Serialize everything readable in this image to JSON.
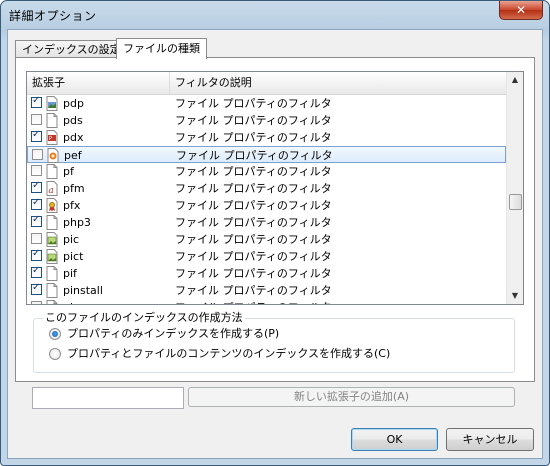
{
  "window": {
    "title": "詳細オプション",
    "close_glyph": "✕"
  },
  "tabs": [
    {
      "label": "インデックスの設定",
      "active": false
    },
    {
      "label": "ファイルの種類",
      "active": true
    }
  ],
  "list": {
    "columns": [
      "拡張子",
      "フィルタの説明"
    ],
    "rows": [
      {
        "ext": "pdp",
        "desc": "ファイル プロパティのフィルタ",
        "checked": true,
        "icon": "document-image-icon"
      },
      {
        "ext": "pds",
        "desc": "ファイル プロパティのフィルタ",
        "checked": false,
        "icon": "blank-document-icon"
      },
      {
        "ext": "pdx",
        "desc": "ファイル プロパティのフィルタ",
        "checked": true,
        "icon": "pdf-document-icon"
      },
      {
        "ext": "pef",
        "desc": "ファイル プロパティのフィルタ",
        "checked": false,
        "icon": "photo-raw-icon",
        "selected": true
      },
      {
        "ext": "pf",
        "desc": "ファイル プロパティのフィルタ",
        "checked": false,
        "icon": "blank-document-icon"
      },
      {
        "ext": "pfm",
        "desc": "ファイル プロパティのフィルタ",
        "checked": true,
        "icon": "font-file-icon"
      },
      {
        "ext": "pfx",
        "desc": "ファイル プロパティのフィルタ",
        "checked": true,
        "icon": "certificate-icon"
      },
      {
        "ext": "php3",
        "desc": "ファイル プロパティのフィルタ",
        "checked": true,
        "icon": "blank-document-icon"
      },
      {
        "ext": "pic",
        "desc": "ファイル プロパティのフィルタ",
        "checked": false,
        "icon": "picture-file-icon"
      },
      {
        "ext": "pict",
        "desc": "ファイル プロパティのフィルタ",
        "checked": true,
        "icon": "picture-file-icon"
      },
      {
        "ext": "pif",
        "desc": "ファイル プロパティのフィルタ",
        "checked": true,
        "icon": "blank-document-icon"
      },
      {
        "ext": "pinstall",
        "desc": "ファイル プロパティのフィルタ",
        "checked": true,
        "icon": "blank-document-icon"
      },
      {
        "ext": "pk",
        "desc": "ファイル プロパティのフィルタ",
        "checked": false,
        "icon": "blank-document-icon"
      }
    ]
  },
  "index_method": {
    "title": "このファイルのインデックスの作成方法",
    "options": [
      {
        "label": "プロパティのみインデックスを作成する(P)",
        "selected": true
      },
      {
        "label": "プロパティとファイルのコンテンツのインデックスを作成する(C)",
        "selected": false
      }
    ]
  },
  "new_extension": {
    "value": "",
    "add_label": "新しい拡張子の追加(A)"
  },
  "buttons": {
    "ok": "OK",
    "cancel": "キャンセル"
  }
}
